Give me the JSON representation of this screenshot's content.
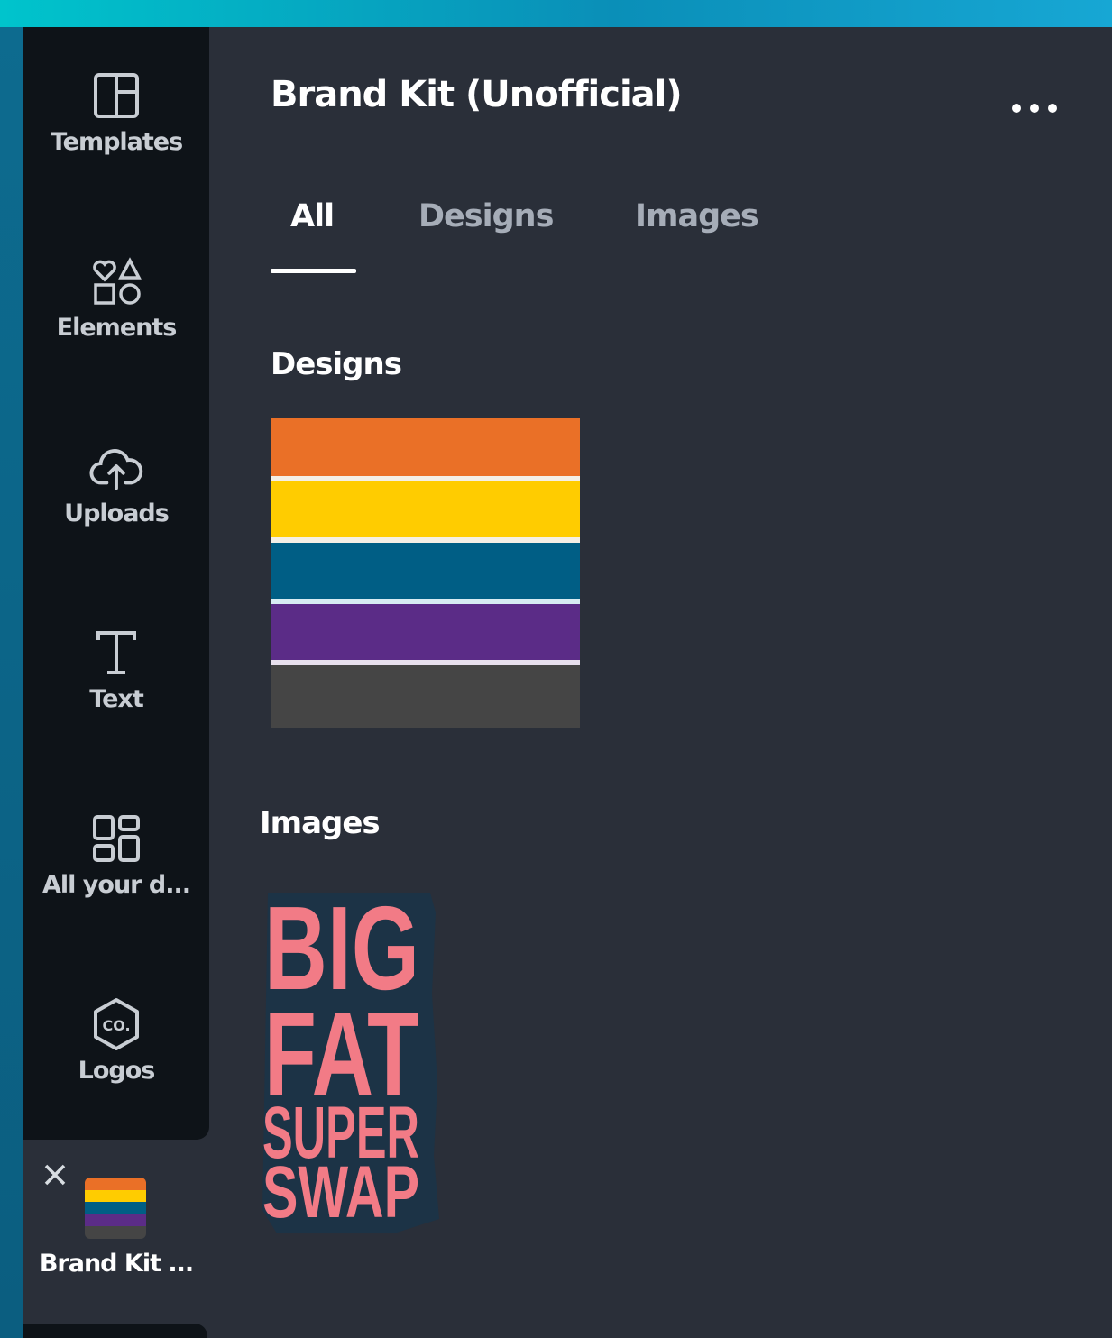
{
  "sidebar": {
    "items": [
      {
        "label": "Templates",
        "icon": "templates-icon"
      },
      {
        "label": "Elements",
        "icon": "elements-icon"
      },
      {
        "label": "Uploads",
        "icon": "upload-cloud-icon"
      },
      {
        "label": "Text",
        "icon": "text-icon"
      },
      {
        "label": "All your d...",
        "icon": "grid-icon"
      },
      {
        "label": "Logos",
        "icon": "logo-badge-icon"
      }
    ],
    "active_item": {
      "label": "Brand Kit ...",
      "close_icon": "close-icon"
    },
    "logo_badge_text": "CO."
  },
  "panel": {
    "title": "Brand Kit (Unofficial)",
    "more_icon": "more-icon",
    "tabs": [
      {
        "label": "All",
        "active": true
      },
      {
        "label": "Designs",
        "active": false
      },
      {
        "label": "Images",
        "active": false
      }
    ],
    "sections": {
      "designs_title": "Designs",
      "images_title": "Images"
    },
    "design_palette": [
      "#ea7027",
      "#ffcc00",
      "#005e85",
      "#5b2c87",
      "#454545"
    ],
    "image_text": [
      "BIG",
      "FAT",
      "SUPER",
      "SWAP"
    ],
    "image_color": "#f27b86"
  },
  "colors": {
    "accent_gradient_start": "#00c4cc",
    "accent_gradient_end": "#17a7d4",
    "sidebar_bg": "#0e1318",
    "panel_bg": "#2a2f39"
  }
}
